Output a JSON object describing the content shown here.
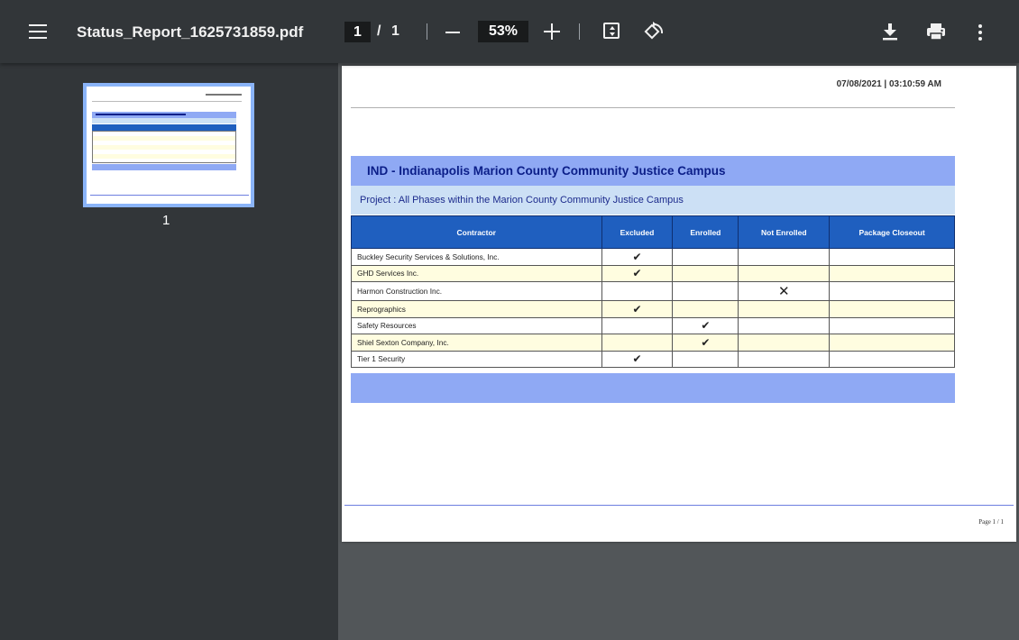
{
  "toolbar": {
    "title": "Status_Report_1625731859.pdf",
    "page_current": "1",
    "page_separator": "/",
    "page_total": "1",
    "zoom": "53%",
    "icons": [
      "menu-icon",
      "minus-icon",
      "plus-icon",
      "fit-to-page-icon",
      "rotate-icon",
      "download-icon",
      "print-icon",
      "more-vert-icon"
    ]
  },
  "sidebar": {
    "thumbnail_label": "1"
  },
  "document": {
    "timestamp": "07/08/2021 | 03:10:59 AM",
    "banner_title": "IND - Indianapolis Marion County Community Justice Campus",
    "project_line": "Project : All Phases within the Marion County Community Justice Campus",
    "columns": [
      "Contractor",
      "Excluded",
      "Enrolled",
      "Not Enrolled",
      "Package Closeout"
    ],
    "rows": [
      {
        "contractor": "Buckley Security Services & Solutions, Inc.",
        "excluded": "✔",
        "enrolled": "",
        "not_enrolled": "",
        "closeout": ""
      },
      {
        "contractor": "GHD Services Inc.",
        "excluded": "✔",
        "enrolled": "",
        "not_enrolled": "",
        "closeout": ""
      },
      {
        "contractor": "Harmon Construction Inc.",
        "excluded": "",
        "enrolled": "",
        "not_enrolled": "✕",
        "closeout": ""
      },
      {
        "contractor": "Reprographics",
        "excluded": "✔",
        "enrolled": "",
        "not_enrolled": "",
        "closeout": ""
      },
      {
        "contractor": "Safety Resources",
        "excluded": "",
        "enrolled": "✔",
        "not_enrolled": "",
        "closeout": ""
      },
      {
        "contractor": "Shiel Sexton Company, Inc.",
        "excluded": "",
        "enrolled": "✔",
        "not_enrolled": "",
        "closeout": ""
      },
      {
        "contractor": "Tier 1 Security",
        "excluded": "✔",
        "enrolled": "",
        "not_enrolled": "",
        "closeout": ""
      }
    ],
    "page_footer": "Page 1 / 1"
  },
  "colors": {
    "toolbar_bg": "#323639",
    "viewer_bg": "#525659",
    "banner": "#8fa9f4",
    "subbanner": "#cce0f5",
    "header_row": "#1f5fbf",
    "alt_row": "#fffde0",
    "check": "#2a8a2a",
    "cross": "#e53935"
  }
}
